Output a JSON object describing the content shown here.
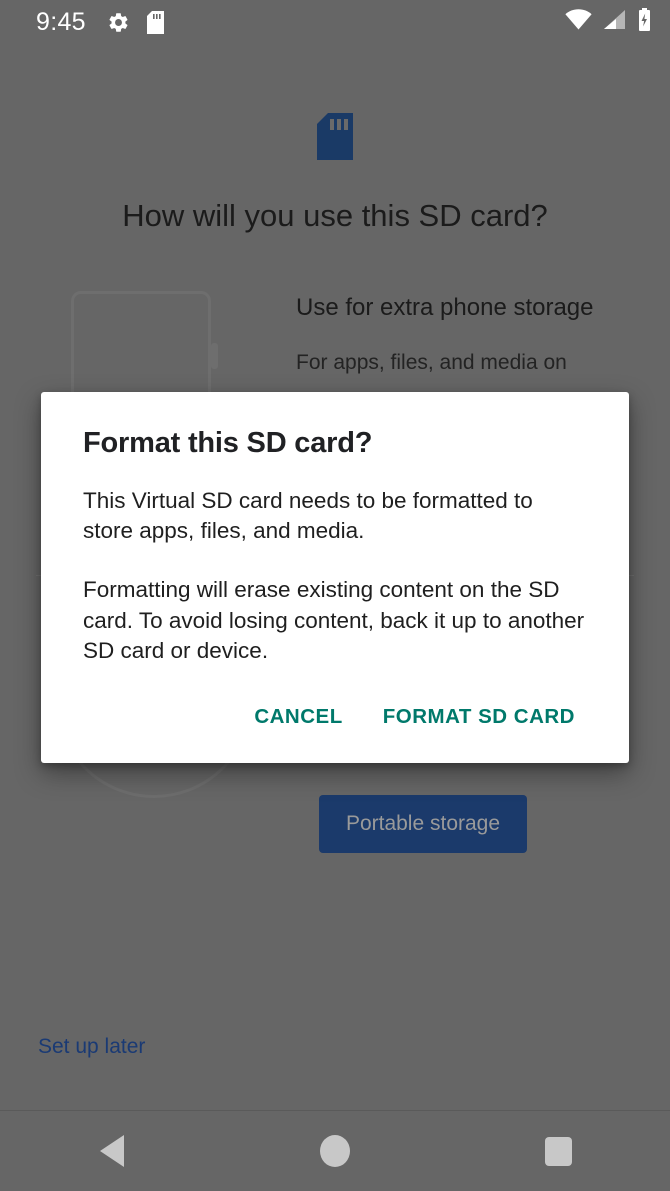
{
  "status_bar": {
    "time": "9:45",
    "left_icons": [
      {
        "name": "gear-icon",
        "glyph": "settings"
      },
      {
        "name": "sd-card-icon",
        "glyph": "sd-card"
      }
    ],
    "right_icons": [
      {
        "name": "wifi-icon",
        "glyph": "wifi-full"
      },
      {
        "name": "cellular-signal-icon",
        "glyph": "signal-low"
      },
      {
        "name": "battery-charging-icon",
        "glyph": "battery-charging"
      }
    ]
  },
  "page": {
    "hero_icon": "sd-card-icon",
    "title": "How will you use this SD card?",
    "options": [
      {
        "title": "Use for extra phone storage",
        "description": "For apps, files, and media on",
        "illustration": "phone-with-sd-card-illustration"
      }
    ],
    "secondary_illustration": "circle-devices-illustration",
    "portable_storage_button": "Portable storage",
    "setup_later_link": "Set up later"
  },
  "dialog": {
    "title": "Format this SD card?",
    "paragraphs": [
      "This Virtual SD card needs to be formatted to store apps, files, and media.",
      "Formatting will erase existing content on the SD card. To avoid losing content, back it up to another SD card or device."
    ],
    "actions": {
      "cancel": "CANCEL",
      "confirm": "FORMAT SD CARD"
    }
  },
  "nav_bar": {
    "back": "back-button",
    "home": "home-button",
    "recents": "recents-button"
  },
  "colors": {
    "scrim": "#666666",
    "dialog_background": "#ffffff",
    "accent_teal": "#00796b",
    "brand_navy": "#1b3a6b",
    "status_bar_text": "#ffffff",
    "nav_icon": "#c8c8c8"
  }
}
